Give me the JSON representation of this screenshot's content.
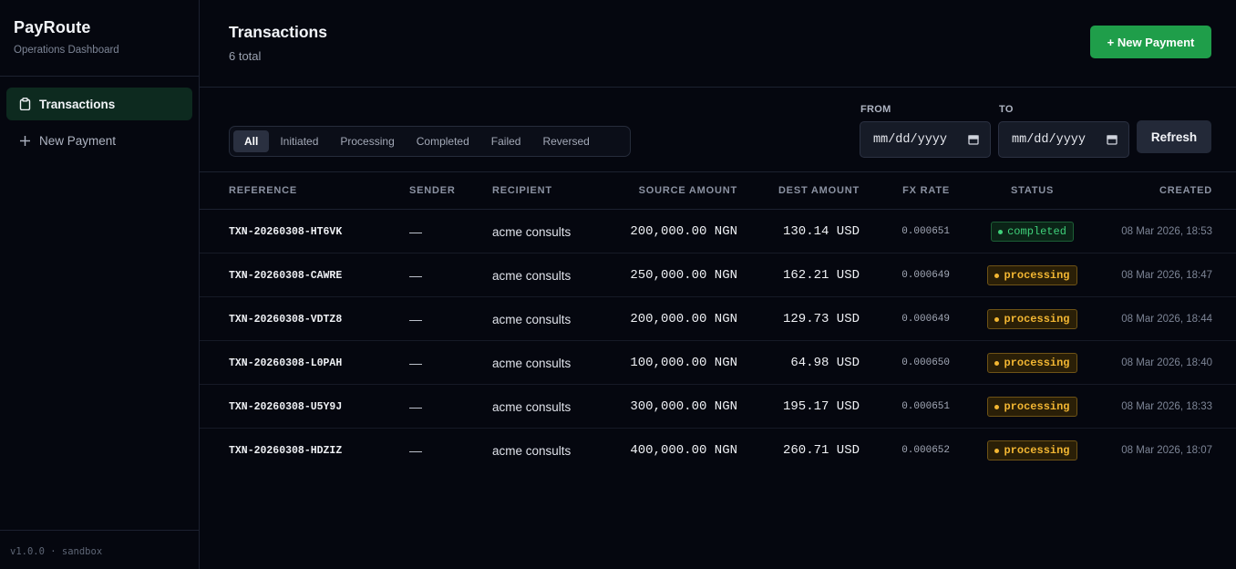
{
  "sidebar": {
    "brand_name": "PayRoute",
    "brand_subtitle": "Operations Dashboard",
    "items": [
      {
        "label": "Transactions",
        "icon": "clipboard-icon",
        "active": true
      },
      {
        "label": "New Payment",
        "icon": "plus-icon",
        "active": false
      }
    ],
    "footer": "v1.0.0 · sandbox"
  },
  "header": {
    "title": "Transactions",
    "count": "6 total",
    "new_payment_label": "+ New Payment"
  },
  "filters": {
    "tabs": [
      "All",
      "Initiated",
      "Processing",
      "Completed",
      "Failed",
      "Reversed"
    ],
    "active": "All"
  },
  "date_range": {
    "from_label": "FROM",
    "from_placeholder": "mm/dd/yyyy",
    "to_label": "TO",
    "to_placeholder": "mm/dd/yyyy",
    "refresh_label": "Refresh"
  },
  "table": {
    "columns": [
      "REFERENCE",
      "SENDER",
      "RECIPIENT",
      "SOURCE AMOUNT",
      "DEST AMOUNT",
      "FX RATE",
      "STATUS",
      "CREATED"
    ],
    "rows": [
      {
        "reference": "TXN-20260308-HT6VK",
        "sender": "—",
        "recipient": "acme consults",
        "source_amount": "200,000.00 NGN",
        "dest_amount": "130.14 USD",
        "fx_rate": "0.000651",
        "status": "completed",
        "created": "08 Mar 2026, 18:53"
      },
      {
        "reference": "TXN-20260308-CAWRE",
        "sender": "—",
        "recipient": "acme consults",
        "source_amount": "250,000.00 NGN",
        "dest_amount": "162.21 USD",
        "fx_rate": "0.000649",
        "status": "processing",
        "created": "08 Mar 2026, 18:47"
      },
      {
        "reference": "TXN-20260308-VDTZ8",
        "sender": "—",
        "recipient": "acme consults",
        "source_amount": "200,000.00 NGN",
        "dest_amount": "129.73 USD",
        "fx_rate": "0.000649",
        "status": "processing",
        "created": "08 Mar 2026, 18:44"
      },
      {
        "reference": "TXN-20260308-L0PAH",
        "sender": "—",
        "recipient": "acme consults",
        "source_amount": "100,000.00 NGN",
        "dest_amount": "64.98 USD",
        "fx_rate": "0.000650",
        "status": "processing",
        "created": "08 Mar 2026, 18:40"
      },
      {
        "reference": "TXN-20260308-U5Y9J",
        "sender": "—",
        "recipient": "acme consults",
        "source_amount": "300,000.00 NGN",
        "dest_amount": "195.17 USD",
        "fx_rate": "0.000651",
        "status": "processing",
        "created": "08 Mar 2026, 18:33"
      },
      {
        "reference": "TXN-20260308-HDZIZ",
        "sender": "—",
        "recipient": "acme consults",
        "source_amount": "400,000.00 NGN",
        "dest_amount": "260.71 USD",
        "fx_rate": "0.000652",
        "status": "processing",
        "created": "08 Mar 2026, 18:07"
      }
    ]
  },
  "colors": {
    "accent": "#1f9e4a",
    "completed": "#3fd07a",
    "processing": "#f2b632",
    "background": "#05070f"
  }
}
